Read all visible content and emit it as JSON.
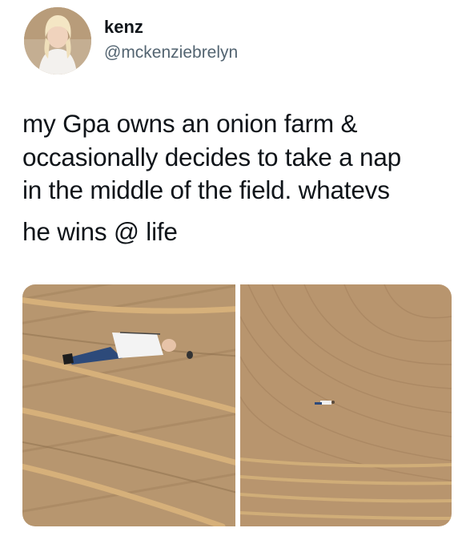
{
  "tweet": {
    "display_name": "kenz",
    "handle": "@mckenziebrelyn",
    "text_line_1": "my Gpa owns an onion farm &",
    "text_line_2": "occasionally decides to take a nap",
    "text_line_3": "in the middle of the field. whatevs",
    "text_line_4": "he wins @ life"
  },
  "media": {
    "photos": [
      {
        "icon": "man-lying-in-field-closeup"
      },
      {
        "icon": "man-lying-in-field-aerial"
      }
    ]
  },
  "colors": {
    "soil": "#b89670",
    "crop_rows": "#c9a56a",
    "shirt": "#f4f4f4",
    "jeans": "#2c4a78",
    "handle_gray": "#536471"
  }
}
